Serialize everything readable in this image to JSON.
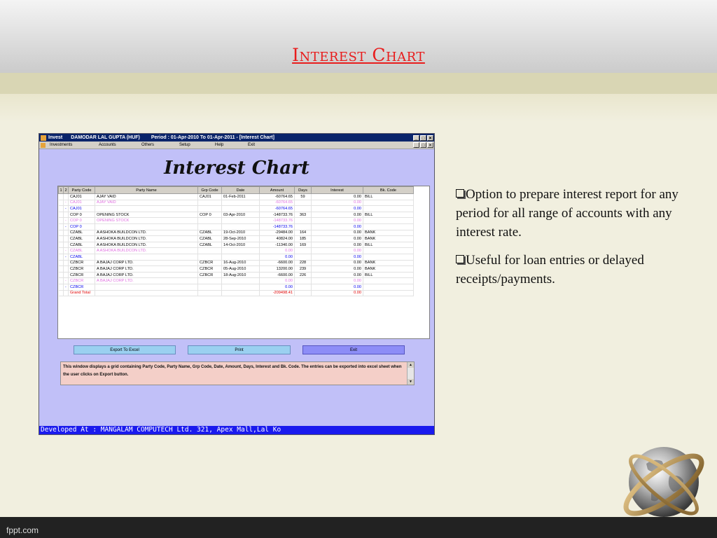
{
  "slide": {
    "title": "Interest Chart",
    "footer": "fppt.com"
  },
  "bullets": [
    "Option to prepare interest report for any period for all range of accounts with any interest rate.",
    "Useful for loan entries or delayed receipts/payments."
  ],
  "window": {
    "app_name": "Invest",
    "company": "DAMODAR LAL GUPTA (HUF)",
    "period": "Period : 01-Apr-2010 To 01-Apr-2011 - [Interest Chart]",
    "menu": [
      "Investments",
      "Accounts",
      "Others",
      "Setup",
      "Help",
      "Exit"
    ],
    "heading": "Interest Chart",
    "grid": {
      "level_tabs": [
        "1",
        "2"
      ],
      "columns": [
        "Party Code",
        "Party Name",
        "Grp Code",
        "Date",
        "Amount",
        "Days",
        "Interest",
        "Bk. Code"
      ],
      "rows": [
        {
          "style": "normal",
          "exp": "",
          "cells": [
            "CAJ01",
            "AJAY VAID",
            "CAJ01",
            "01-Feb-2011",
            "-60764.65",
            "59",
            "0.00",
            "BILL"
          ]
        },
        {
          "style": "pink",
          "exp": "-",
          "cells": [
            "CAJ01",
            "AJAY VAID",
            "",
            "",
            "-60764.65",
            "",
            "0.00",
            ""
          ]
        },
        {
          "style": "blue",
          "exp": "-",
          "cells": [
            "CAJ01",
            "",
            "",
            "",
            "-60764.65",
            "",
            "0.00",
            ""
          ]
        },
        {
          "style": "normal",
          "exp": "",
          "cells": [
            "COP 0",
            "OPENING STOCK",
            "COP 0",
            "03-Apr-2010",
            "-148733.76",
            "363",
            "0.00",
            "BILL"
          ]
        },
        {
          "style": "pink",
          "exp": "-",
          "cells": [
            "COP 0",
            "OPENING STOCK",
            "",
            "",
            "-148733.76",
            "",
            "0.00",
            ""
          ]
        },
        {
          "style": "blue",
          "exp": "-",
          "cells": [
            "COP 0",
            "",
            "",
            "",
            "-148733.76",
            "",
            "0.00",
            ""
          ]
        },
        {
          "style": "normal",
          "exp": "",
          "cells": [
            "CZABL",
            "A ASHOKA BUILDCON LTD.",
            "CZABL",
            "19-Oct-2010",
            "-29484.00",
            "164",
            "0.00",
            "BANK"
          ]
        },
        {
          "style": "normal",
          "exp": "",
          "cells": [
            "CZABL",
            "A ASHOKA BUILDCON LTD.",
            "CZABL",
            "28-Sep-2010",
            "40824.00",
            "185",
            "0.00",
            "BANK"
          ]
        },
        {
          "style": "normal",
          "exp": "",
          "cells": [
            "CZABL",
            "A ASHOKA BUILDCON LTD.",
            "CZABL",
            "14-Oct-2010",
            "-11340.00",
            "169",
            "0.00",
            "BILL"
          ]
        },
        {
          "style": "pink",
          "exp": "-",
          "cells": [
            "CZABL",
            "A ASHOKA BUILDCON LTD.",
            "",
            "",
            "0.00",
            "",
            "0.00",
            ""
          ]
        },
        {
          "style": "blue",
          "exp": "-",
          "cells": [
            "CZABL",
            "",
            "",
            "",
            "0.00",
            "",
            "0.00",
            ""
          ]
        },
        {
          "style": "normal",
          "exp": "",
          "cells": [
            "CZBCR",
            "A BAJAJ CORP LTD.",
            "CZBCR",
            "16-Aug-2010",
            "-6600.00",
            "228",
            "0.00",
            "BANK"
          ]
        },
        {
          "style": "normal",
          "exp": "",
          "cells": [
            "CZBCR",
            "A BAJAJ CORP LTD.",
            "CZBCR",
            "05-Aug-2010",
            "13200.00",
            "239",
            "0.00",
            "BANK"
          ]
        },
        {
          "style": "normal",
          "exp": "",
          "cells": [
            "CZBCR",
            "A BAJAJ CORP LTD.",
            "CZBCR",
            "18-Aug-2010",
            "-6600.00",
            "226",
            "0.00",
            "BILL"
          ]
        },
        {
          "style": "pink",
          "exp": "-",
          "cells": [
            "CZBCR",
            "A BAJAJ CORP LTD.",
            "",
            "",
            "0.00",
            "",
            "0.00",
            ""
          ]
        },
        {
          "style": "blue",
          "exp": "-",
          "cells": [
            "CZBCR",
            "",
            "",
            "",
            "0.00",
            "",
            "0.00",
            ""
          ]
        },
        {
          "style": "red",
          "exp": "",
          "cells": [
            "Grand Total",
            "",
            "",
            "",
            "-209498.41",
            "",
            "0.00",
            ""
          ]
        }
      ]
    },
    "buttons": {
      "export": "Export To Excel",
      "print": "Print",
      "exit": "Exit"
    },
    "description": "This window displays a grid containing Party Code, Party Name, Grp Code, Date, Amount, Days, Interest and Bk. Code. The entries can be exported into excel sheet when the user clicks on Export button.",
    "status": "Developed At : MANGALAM COMPUTECH Ltd. 321, Apex Mall,Lal Ko"
  },
  "colors": {
    "title_red": "#e81d1d",
    "window_bg": "#c1c0f8",
    "status_blue": "#1a1aee"
  }
}
